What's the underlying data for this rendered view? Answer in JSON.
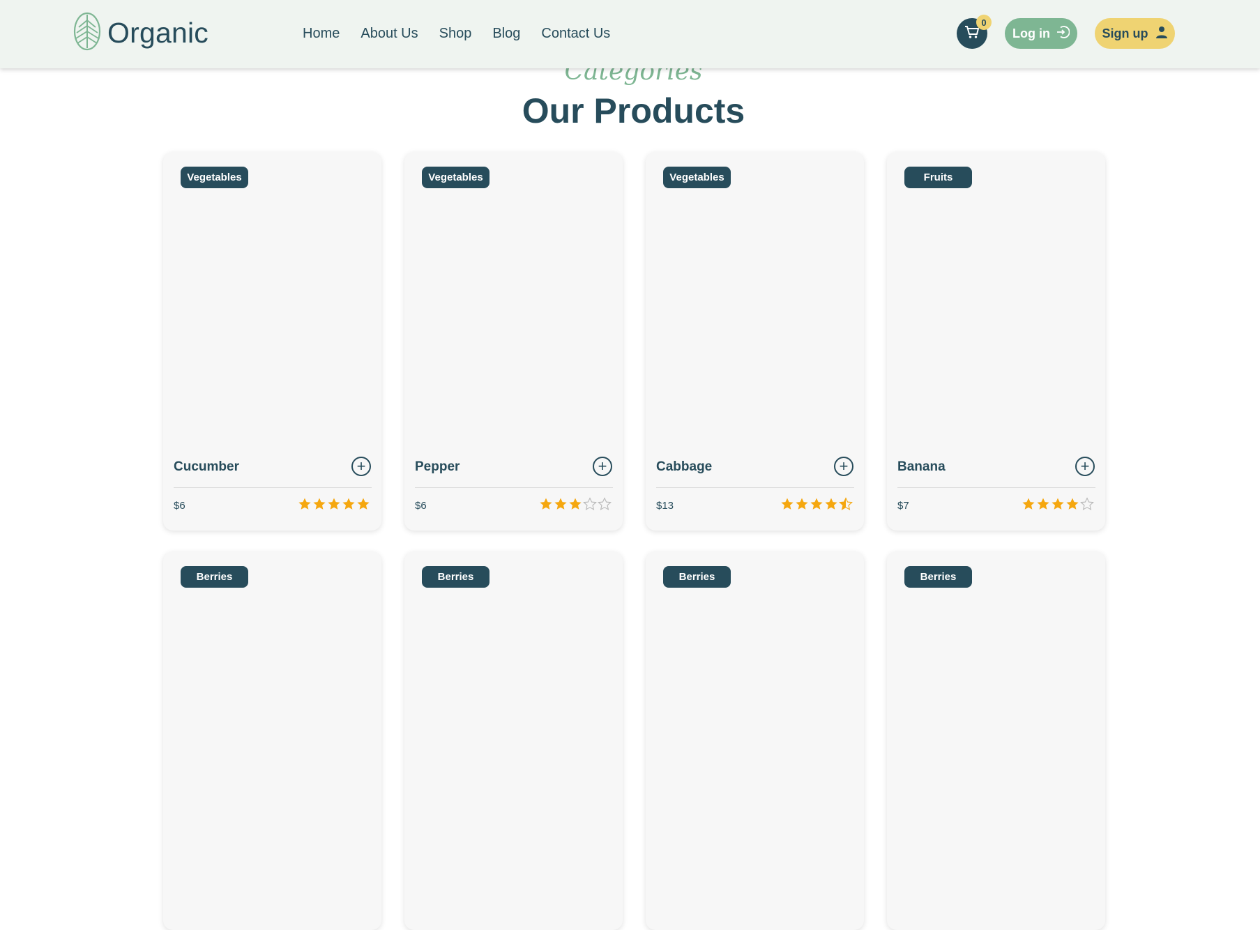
{
  "header": {
    "logo_text": "Organic",
    "nav": [
      "Home",
      "About Us",
      "Shop",
      "Blog",
      "Contact Us"
    ],
    "cart_count": "0",
    "login_label": "Log in",
    "signup_label": "Sign up"
  },
  "section": {
    "subtitle": "Categories",
    "title": "Our Products"
  },
  "products": [
    {
      "category": "Vegetables",
      "name": "Cucumber",
      "price": "$6",
      "rating": 5
    },
    {
      "category": "Vegetables",
      "name": "Pepper",
      "price": "$6",
      "rating": 3
    },
    {
      "category": "Vegetables",
      "name": "Cabbage",
      "price": "$13",
      "rating": 4.5
    },
    {
      "category": "Fruits",
      "name": "Banana",
      "price": "$7",
      "rating": 4
    },
    {
      "category": "Berries",
      "name": "",
      "price": "",
      "rating": null
    },
    {
      "category": "Berries",
      "name": "",
      "price": "",
      "rating": null
    },
    {
      "category": "Berries",
      "name": "",
      "price": "",
      "rating": null
    },
    {
      "category": "Berries",
      "name": "",
      "price": "",
      "rating": null
    }
  ],
  "colors": {
    "primary": "#274c5b",
    "accent_green": "#7eb693",
    "accent_yellow": "#efd372",
    "star": "#f5a70f",
    "header_bg": "#eff4f0"
  },
  "icons": {
    "logo": "leaf-icon",
    "cart": "cart-icon",
    "login": "login-arrow-icon",
    "signup": "user-icon",
    "add": "plus-circle-icon",
    "rating": "star-icon"
  }
}
